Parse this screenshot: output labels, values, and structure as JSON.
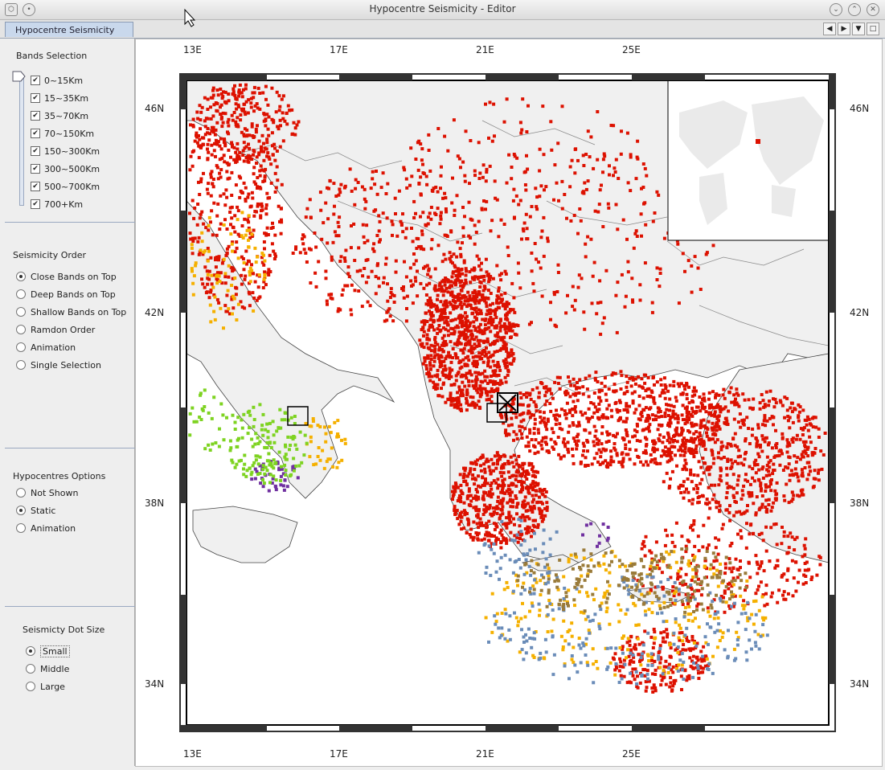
{
  "window": {
    "title": "Hypocentre Seismicity - Editor"
  },
  "tab": {
    "label": "Hypocentre Seismicity"
  },
  "bands": {
    "title": "Bands Selection",
    "items": [
      "0~15Km",
      "15~35Km",
      "35~70Km",
      "70~150Km",
      "150~300Km",
      "300~500Km",
      "500~700Km",
      "700+Km"
    ]
  },
  "order": {
    "title": "Seismicity Order",
    "options": [
      "Close Bands on Top",
      "Deep Bands on Top",
      "Shallow Bands on Top",
      "Ramdon Order",
      "Animation",
      "Single Selection"
    ],
    "selected": 0
  },
  "hypo": {
    "title": "Hypocentres Options",
    "options": [
      "Not Shown",
      "Static",
      "Animation"
    ],
    "selected": 1
  },
  "dotsize": {
    "title": "Seismicty Dot Size",
    "options": [
      "Small",
      "Middle",
      "Large"
    ],
    "selected": 0
  },
  "map": {
    "lon_labels": [
      "13E",
      "17E",
      "21E",
      "25E"
    ],
    "lat_labels": [
      "46N",
      "42N",
      "38N",
      "34N"
    ],
    "colors": {
      "shallow": "#dd1100",
      "band2": "#f5b000",
      "band3": "#6a8cb8",
      "band4": "#9a7b3a",
      "band5": "#7030a0",
      "band6": "#7ed321",
      "land": "#f0f0f0",
      "coast": "#444444"
    }
  }
}
